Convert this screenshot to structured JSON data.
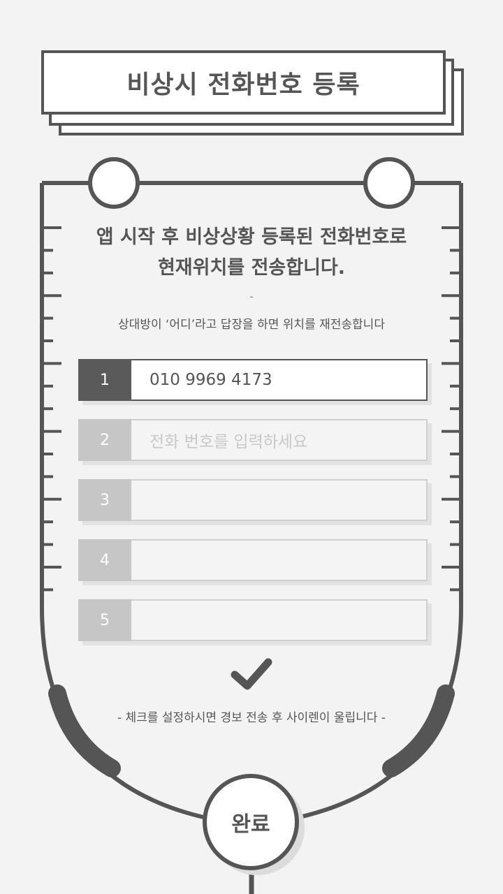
{
  "header": {
    "title": "비상시 전화번호 등록"
  },
  "description": {
    "line1": "앱 시작 후 비상상황 등록된 전화번호로",
    "line2": "현재위치를 전송합니다.",
    "dash": "-",
    "sub": "상대방이 ‘어디’라고 답장을 하면 위치를 재전송합니다"
  },
  "phones": {
    "placeholder": "전화 번호를 입력하세요",
    "items": [
      {
        "index": "1",
        "value": "010 9969 4173",
        "placeholder": ""
      },
      {
        "index": "2",
        "value": "",
        "placeholder": "전화 번호를 입력하세요"
      },
      {
        "index": "3",
        "value": "",
        "placeholder": ""
      },
      {
        "index": "4",
        "value": "",
        "placeholder": ""
      },
      {
        "index": "5",
        "value": "",
        "placeholder": ""
      }
    ]
  },
  "alarm": {
    "checked": true,
    "note": "- 체크를 설정하시면 경보 전송 후 사이렌이 울립니다 -"
  },
  "done_button": {
    "label": "완료"
  },
  "colors": {
    "background": "#f3f3f3",
    "primary": "#555555",
    "inactive": "#c6c6c6",
    "placeholder": "#c8c8c8"
  }
}
